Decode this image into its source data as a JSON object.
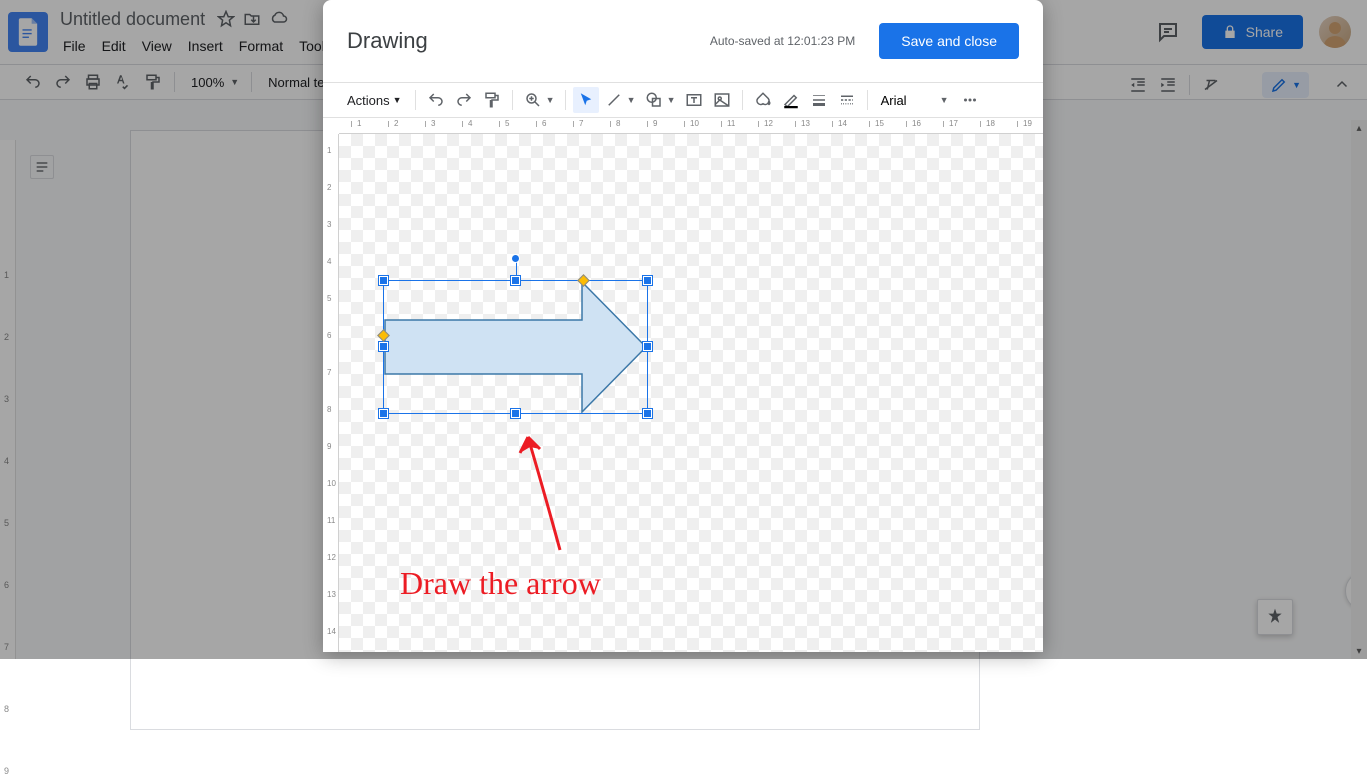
{
  "docs": {
    "title": "Untitled document",
    "menu": [
      "File",
      "Edit",
      "View",
      "Insert",
      "Format",
      "Tools"
    ],
    "share": "Share",
    "zoom": "100%",
    "style": "Normal text"
  },
  "dialog": {
    "title": "Drawing",
    "autosave": "Auto-saved at 12:01:23 PM",
    "save_close": "Save and close",
    "actions": "Actions",
    "font": "Arial",
    "ruler_h": [
      1,
      2,
      3,
      4,
      5,
      6,
      7,
      8,
      9,
      10,
      11,
      12,
      13,
      14,
      15,
      16,
      17,
      18,
      19
    ],
    "ruler_v": [
      1,
      2,
      3,
      4,
      5,
      6,
      7,
      8,
      9,
      10,
      11,
      12,
      13,
      14
    ]
  },
  "annotation": {
    "text": "Draw the arrow"
  },
  "doc_ruler_v": [
    1,
    2,
    3,
    4,
    5,
    6,
    7,
    8,
    9
  ]
}
